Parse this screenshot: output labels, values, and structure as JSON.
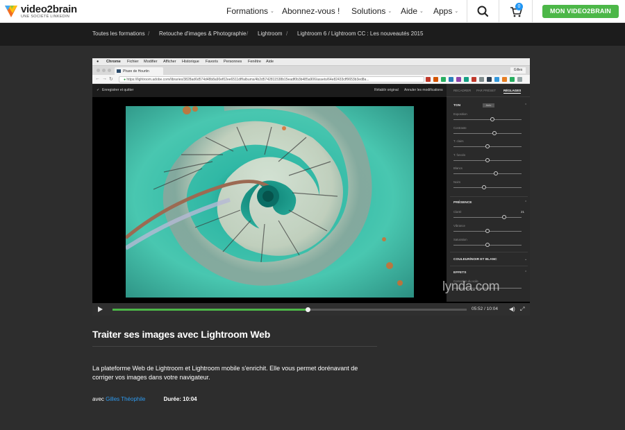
{
  "header": {
    "brand": "video2brain",
    "brand_sub": "UNE SOCIÉTÉ LINKEDIN",
    "nav": [
      {
        "label": "Formations",
        "dropdown": true
      },
      {
        "label": "Abonnez-vous !",
        "dropdown": false
      },
      {
        "label": "Solutions",
        "dropdown": true
      },
      {
        "label": "Aide",
        "dropdown": true
      },
      {
        "label": "Apps",
        "dropdown": true
      }
    ],
    "search_icon": "search-icon",
    "cart_icon": "cart-icon",
    "cart_count": "0",
    "cta_label": "MON VIDEO2BRAIN",
    "colors": {
      "cta": "#4cb748",
      "badge": "#2196f3"
    }
  },
  "breadcrumb": [
    "Toutes les formations",
    "Retouche d'images & Photographie",
    "Lightroom",
    "Lightroom 6 / Lightroom CC : Les nouveautés 2015"
  ],
  "video": {
    "screen": {
      "mac_menu": [
        "Chrome",
        "Fichier",
        "Modifier",
        "Afficher",
        "Historique",
        "Favoris",
        "Personnes",
        "Fenêtre",
        "Aide"
      ],
      "tab_title": "Phare de Hourtin",
      "profile": "Gilles",
      "url": "https://lightroom.adobe.com/libraries/3828ad6d574d48b8a90ef02ee6511dff/albums/4b2d5742811538b15eadf0b3b485a906/assets/64e82433cff9653b3ed8a...",
      "toolbar_left": "Enregistrer et quitter",
      "toolbar_reset": "Rétablir original",
      "toolbar_cancel": "Annuler les modifications",
      "panel_tabs": [
        "RECADRER",
        "PAR PRÉSET",
        "RÉGLAGES"
      ],
      "section_ton": "TON",
      "auto_label": "Auto",
      "ton_sliders": [
        {
          "label": "Exposition",
          "value": 0.57
        },
        {
          "label": "Contraste",
          "value": 0.6
        },
        {
          "label": "T. clairs",
          "value": 0.5
        },
        {
          "label": "T. foncés",
          "value": 0.5
        },
        {
          "label": "Blancs",
          "value": 0.62
        },
        {
          "label": "Noirs",
          "value": 0.45
        }
      ],
      "section_presence": "PRÉSENCE",
      "presence_sliders": [
        {
          "label": "Clarté",
          "value": 0.74,
          "display": "21"
        },
        {
          "label": "Vibrance",
          "value": 0.5,
          "display": ""
        },
        {
          "label": "Saturation",
          "value": 0.5,
          "display": ""
        }
      ],
      "section_color": "COULEUR/NOIR ET BLANC",
      "section_effects": "EFFETS",
      "effects_first": "Correction du voile",
      "watermark": "lynda.com"
    },
    "progress": 0.55,
    "time": "05:52 / 10:04"
  },
  "course": {
    "title": "Traiter ses images avec Lightroom Web",
    "description": "La plateforme Web de Lightroom et Lightroom mobile s'enrichit. Elle vous permet dorénavant de corriger vos images dans votre navigateur.",
    "author_prefix": "avec",
    "author": "Gilles Théophile",
    "duration": "Durée: 10:04"
  }
}
